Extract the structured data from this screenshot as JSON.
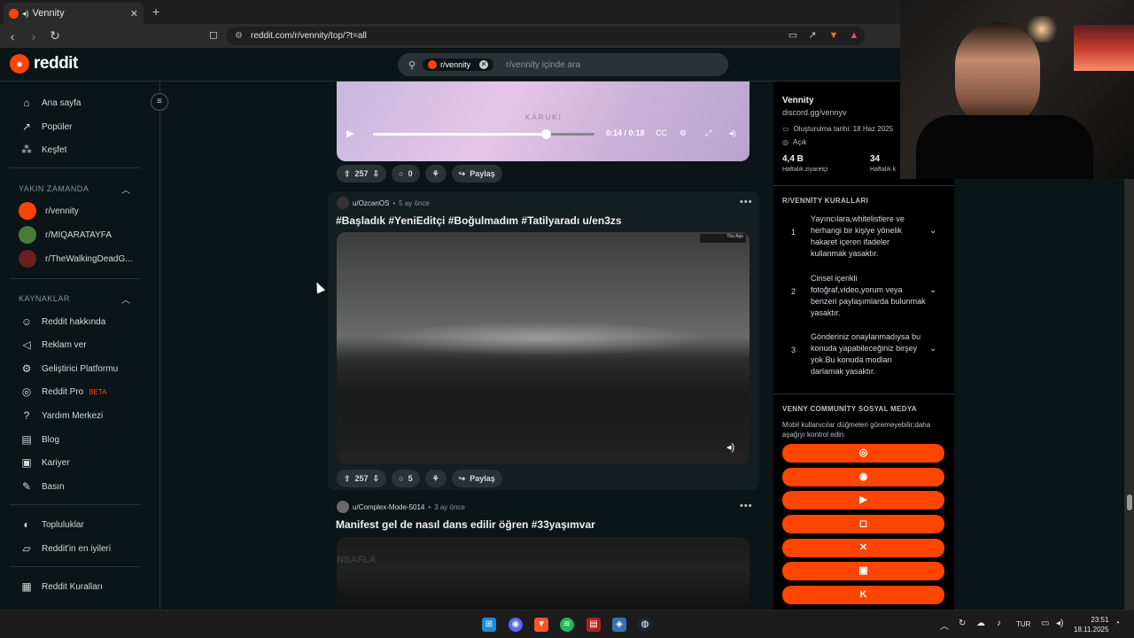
{
  "browser": {
    "tab_title": "Vennity",
    "url": "reddit.com/r/vennity/top/?t=all"
  },
  "header": {
    "logo_text": "reddit",
    "search_chip": "r/vennity",
    "search_placeholder": "r/vennity içinde ara"
  },
  "sidebar": {
    "main": [
      {
        "label": "Ana sayfa",
        "icon": "home-icon"
      },
      {
        "label": "Popüler",
        "icon": "popular-icon"
      },
      {
        "label": "Keşfet",
        "icon": "explore-icon"
      }
    ],
    "recent_title": "YAKIN ZAMANDA",
    "recent": [
      {
        "label": "r/vennity",
        "color": "#ff4500"
      },
      {
        "label": "r/MIQARATAYFA",
        "color": "#4a7a3a"
      },
      {
        "label": "r/TheWalkingDeadG...",
        "color": "#6b1f1f"
      }
    ],
    "resources_title": "KAYNAKLAR",
    "resources": [
      {
        "label": "Reddit hakkında",
        "icon": "reddit-icon"
      },
      {
        "label": "Reklam ver",
        "icon": "megaphone-icon"
      },
      {
        "label": "Geliştirici Platformu",
        "icon": "developer-icon"
      },
      {
        "label": "Reddit Pro",
        "icon": "pro-icon",
        "badge": "BETA"
      },
      {
        "label": "Yardım Merkezi",
        "icon": "help-icon"
      },
      {
        "label": "Blog",
        "icon": "blog-icon"
      },
      {
        "label": "Kariyer",
        "icon": "career-icon"
      },
      {
        "label": "Basın",
        "icon": "press-icon"
      }
    ],
    "more": [
      {
        "label": "Topluluklar",
        "icon": "communities-icon"
      },
      {
        "label": "Reddit'in en iyileri",
        "icon": "best-icon"
      }
    ],
    "bottom": [
      {
        "label": "Reddit Kuralları",
        "icon": "rules-icon"
      }
    ]
  },
  "feed": {
    "video1": {
      "watermark": "KARUKI",
      "time": "0:14 / 0:18",
      "progress": 0.78
    },
    "post0_actions": {
      "votes": "257",
      "comments": "0",
      "share": "Paylaş"
    },
    "post1": {
      "user": "u/OzcanOS",
      "ago": "5 ay önce",
      "title": "#Başladık #YeniEditçi #Boğulmadım #Tatilyaradı u/en3zs",
      "hud": "The Age",
      "votes": "257",
      "comments": "5",
      "share": "Paylaş"
    },
    "post2": {
      "user": "u/Complex-Mode-5014",
      "ago": "3 ay önce",
      "title": "Manifest gel de nasıl dans edilir öğren #33yaşımvar",
      "media_text": "NSAFLA"
    }
  },
  "right_sidebar": {
    "name": "Vennity",
    "link": "discord.gg/vennyv",
    "created": "Oluşturulma tarihi: 18 Haz 2025",
    "status": "Açık",
    "stats": [
      {
        "value": "4,4 B",
        "label": "Haftalık ziyaretçi"
      },
      {
        "value": "34",
        "label": "Haftalık k"
      }
    ],
    "rules_title": "R/VENNİTY KURALLARI",
    "rules": [
      {
        "n": "1",
        "text": "Yayıncılara,whitelistlere ve herhangi bir kişiye yönelik hakaret içeren ifadeler kullanmak yasaktır."
      },
      {
        "n": "2",
        "text": "Cinsel içerikli fotoğraf,video,yorum veya benzeri paylaşımlarda bulunmak yasaktır."
      },
      {
        "n": "3",
        "text": "Gönderiniz onaylanmadıysa bu konuda yapabileceğiniz birşey yok.Bu konuda modları darlamak yasaktır."
      }
    ],
    "social_title": "VENNY COMMUNİTY SOSYAL MEDYA",
    "social_desc": "Mobil kullanıcılar düğmeleri göremeyebilir;daha aşağıyı kontrol edin.",
    "social_buttons": [
      {
        "icon": "globe-icon",
        "glyph": "◎"
      },
      {
        "icon": "discord-icon",
        "glyph": "◉"
      },
      {
        "icon": "youtube-icon",
        "glyph": "▶"
      },
      {
        "icon": "instagram-icon",
        "glyph": "◻"
      },
      {
        "icon": "x-icon",
        "glyph": "✕"
      },
      {
        "icon": "twitch-icon",
        "glyph": "▣"
      },
      {
        "icon": "kick-icon",
        "glyph": "K"
      }
    ]
  },
  "taskbar": {
    "lang": "TUR",
    "time": "23:51",
    "date": "18.11.2025"
  }
}
